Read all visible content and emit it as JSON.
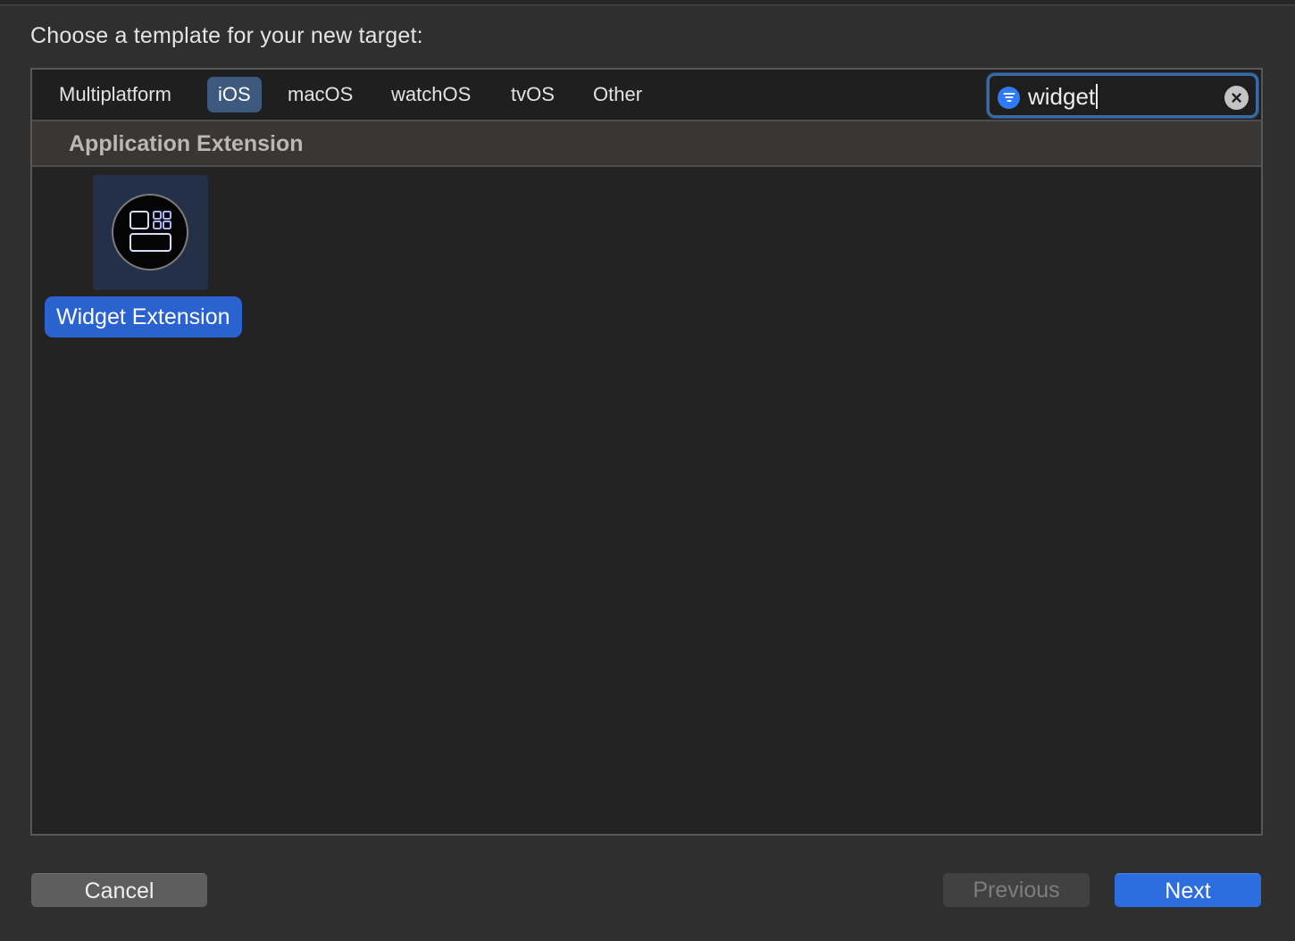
{
  "sheet": {
    "title": "Choose a template for your new target:"
  },
  "tabs": [
    {
      "label": "Multiplatform",
      "selected": false
    },
    {
      "label": "iOS",
      "selected": true
    },
    {
      "label": "macOS",
      "selected": false
    },
    {
      "label": "watchOS",
      "selected": false
    },
    {
      "label": "tvOS",
      "selected": false
    },
    {
      "label": "Other",
      "selected": false
    }
  ],
  "search": {
    "value": "widget",
    "filter_icon": "filter-icon",
    "clear_icon": "clear-icon"
  },
  "section": {
    "title": "Application Extension"
  },
  "templates": [
    {
      "label": "Widget Extension",
      "icon": "widget-extension-icon",
      "selected": true
    }
  ],
  "buttons": {
    "cancel": "Cancel",
    "previous": "Previous",
    "next": "Next"
  },
  "colors": {
    "accent": "#2c6de0",
    "selection": "#2a62cf",
    "selected_tab": "#3d5a7e"
  }
}
